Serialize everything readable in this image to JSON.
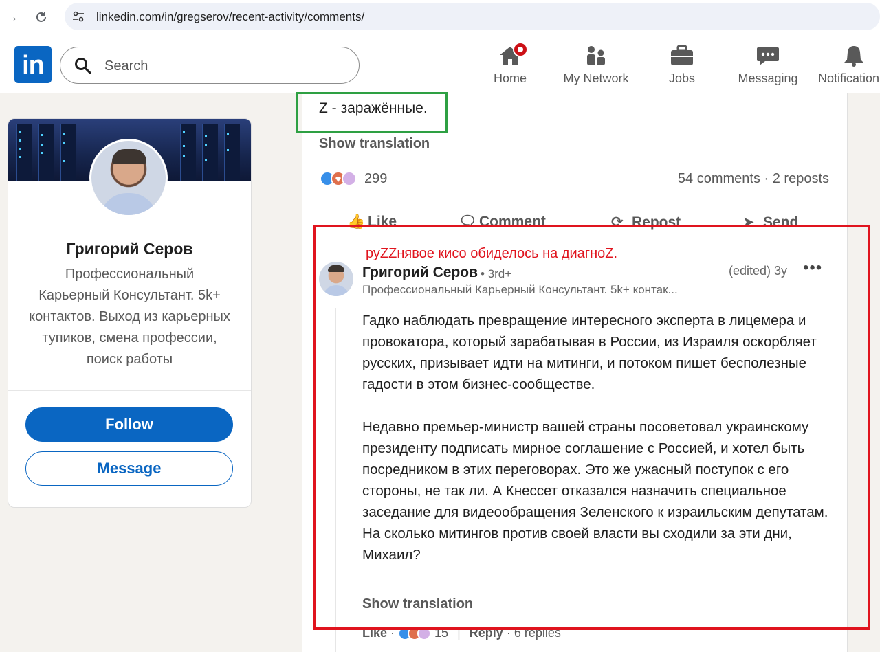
{
  "browser": {
    "url": "linkedin.com/in/gregserov/recent-activity/comments/"
  },
  "header": {
    "logo": "in",
    "search_placeholder": "Search",
    "nav": [
      {
        "label": "Home",
        "icon": "home-icon"
      },
      {
        "label": "My Network",
        "icon": "network-icon"
      },
      {
        "label": "Jobs",
        "icon": "briefcase-icon"
      },
      {
        "label": "Messaging",
        "icon": "message-icon"
      },
      {
        "label": "Notification",
        "icon": "bell-icon"
      }
    ]
  },
  "profile": {
    "name": "Григорий Серов",
    "headline": "Профессиональный Карьерный Консультант. 5k+ контактов. Выход из карьерных тупиков, смена профессии, поиск работы",
    "follow_label": "Follow",
    "message_label": "Message"
  },
  "post": {
    "text": "Z - заражённые.",
    "show_translation": "Show translation",
    "reaction_count": "299",
    "stats": "54 comments · 2 reposts",
    "actions": [
      "Like",
      "Comment",
      "Repost",
      "Send"
    ]
  },
  "annotation": "руZZнявое кисо обиделось на диагноZ.",
  "comment": {
    "author": "Григорий Серов",
    "degree": "• 3rd+",
    "time": "(edited) 3y",
    "more": "•••",
    "subtitle": "Профессиональный Карьерный Консультант. 5k+ контак...",
    "paragraph1": "Гадко наблюдать превращение интересного эксперта в лицемера и провокатора, который зарабатывая в России, из Израиля оскорбляет русских, призывает идти на митинги, и потоком пишет бесполезные гадости в этом бизнес-сообществе.",
    "paragraph2": "Недавно премьер-министр вашей страны посоветовал украинскому президенту подписать мирное соглашение с Россией, и хотел быть посредником в этих переговорах. Это же ужасный поступок с его стороны, не так ли. А Кнессет отказался назначить специальное заседание для видеообращения Зеленского к израильским депутатам.",
    "paragraph3": "На сколько митингов против своей власти вы сходили за эти дни, Михаил?",
    "show_translation": "Show translation",
    "like": "Like",
    "reactions": "15",
    "reply": "Reply",
    "replies": "6 replies"
  },
  "colors": {
    "brand": "#0a66c2",
    "annotation_red": "#e0141e",
    "annotation_green": "#2ea043",
    "notification_badge": "#cc1016"
  }
}
